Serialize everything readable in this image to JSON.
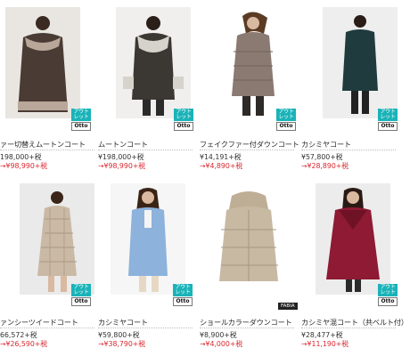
{
  "products": [
    {
      "name": "ァー切替えムートンコート",
      "price": "198,000+税",
      "sale": "→¥98,990+税",
      "badge_top": "アウトレット",
      "badge_brand": "Otto",
      "coat_color": "#4a3c34",
      "trim_color": "#b9a89a"
    },
    {
      "name": "ムートンコート",
      "price": "¥198,000+税",
      "sale": "→¥98,990+税",
      "badge_top": "アウトレット",
      "badge_brand": "Otto",
      "coat_color": "#3b3733",
      "trim_color": "#d6d2cc"
    },
    {
      "name": "フェイクファー付ダウンコート",
      "price": "¥14,191+税",
      "sale": "→¥4,890+税",
      "badge_top": "アウトレット",
      "badge_brand": "Otto",
      "coat_color": "#8b7a72",
      "trim_color": "#8b7a72"
    },
    {
      "name": "カシミヤコート",
      "price": "¥57,800+税",
      "sale": "→¥28,890+税",
      "badge_top": "アウトレット",
      "badge_brand": "Otto",
      "coat_color": "#1f3b3d",
      "trim_color": "#1f3b3d"
    },
    {
      "name": "ァンシーツイードコート",
      "price": "66,572+税",
      "sale": "→¥26,590+税",
      "badge_top": "アウトレット",
      "badge_brand": "Otto",
      "coat_color": "#c9b9a5",
      "trim_color": "#c9b9a5"
    },
    {
      "name": "カシミヤコート",
      "price": "¥59,800+税",
      "sale": "→¥38,790+税",
      "badge_top": "アウトレット",
      "badge_brand": "Otto",
      "coat_color": "#8db2dc",
      "trim_color": "#8db2dc"
    },
    {
      "name": "ショールカラーダウンコート",
      "price": "¥8,900+税",
      "sale": "→¥4,000+税",
      "brand_tag": "FABIA",
      "coat_color": "#c7b9a2",
      "trim_color": "#c7b9a2"
    },
    {
      "name": "カシミヤ混コート（共ベルト付）",
      "price": "¥28,477+税",
      "sale": "→¥11,190+税",
      "badge_top": "アウトレット",
      "badge_brand": "Otto",
      "coat_color": "#8e1a33",
      "trim_color": "#8e1a33"
    }
  ]
}
